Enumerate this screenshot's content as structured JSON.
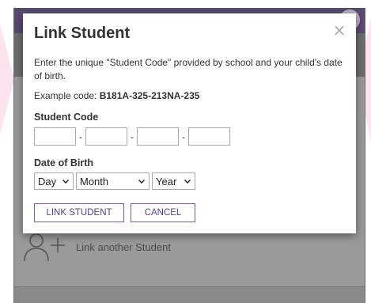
{
  "modal": {
    "title": "Link Student",
    "close_glyph": "×",
    "description": "Enter the unique \"Student Code\" provided by school and your child's date of birth.",
    "example_prefix": "Example code: ",
    "example_code": "B181A-325-213NA-235",
    "student_code_label": "Student Code",
    "code_separator": "-",
    "code_values": [
      "",
      "",
      "",
      ""
    ],
    "dob_label": "Date of Birth",
    "day_selected": "Day",
    "month_selected": "Month",
    "year_selected": "Year",
    "link_button_label": "LINK STUDENT",
    "cancel_button_label": "CANCEL"
  },
  "background": {
    "link_another_label": "Link another Student"
  },
  "colors": {
    "accent": "#5d3e86",
    "button_border": "#7a5a9c",
    "header": "#5a4a70",
    "overlay": "#7e7e7e",
    "pink_decor": "#fbe4ee"
  },
  "icons": {
    "close": "close-icon",
    "dropdown": "chevron-down-icon",
    "add_user": "add-user-icon"
  }
}
